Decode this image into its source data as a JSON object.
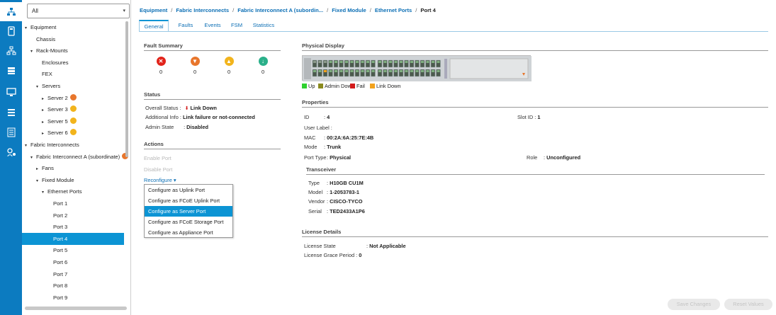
{
  "rail": {
    "icons": [
      "network-icon",
      "server-icon",
      "lan-icon",
      "storage-icon",
      "chassis-icon",
      "policy-icon",
      "list-icon",
      "admin-icon"
    ],
    "accent": "#0c7bc0"
  },
  "filter": {
    "value": "All"
  },
  "tree": [
    {
      "label": "Equipment",
      "toggle": "▾",
      "level": 0
    },
    {
      "label": "Chassis",
      "toggle": "",
      "level": 1
    },
    {
      "label": "Rack-Mounts",
      "toggle": "▾",
      "level": 1
    },
    {
      "label": "Enclosures",
      "toggle": "",
      "level": 2
    },
    {
      "label": "FEX",
      "toggle": "",
      "level": 2
    },
    {
      "label": "Servers",
      "toggle": "▾",
      "level": 2
    },
    {
      "label": "Server 2",
      "toggle": "▸",
      "level": 3,
      "badge": "#e8762c"
    },
    {
      "label": "Server 3",
      "toggle": "▸",
      "level": 3,
      "badge": "#f2b41c"
    },
    {
      "label": "Server 5",
      "toggle": "▸",
      "level": 3,
      "badge": "#f2b41c"
    },
    {
      "label": "Server 6",
      "toggle": "▸",
      "level": 3,
      "badge": "#f2b41c"
    },
    {
      "label": "Fabric Interconnects",
      "toggle": "▾",
      "level": 0
    },
    {
      "label": "Fabric Interconnect A (subordinate)",
      "toggle": "▾",
      "level": 1,
      "badge": "#e8762c"
    },
    {
      "label": "Fans",
      "toggle": "▸",
      "level": 2
    },
    {
      "label": "Fixed Module",
      "toggle": "▾",
      "level": 2
    },
    {
      "label": "Ethernet Ports",
      "toggle": "▾",
      "level": 3
    },
    {
      "label": "Port 1",
      "toggle": "",
      "level": 4
    },
    {
      "label": "Port 2",
      "toggle": "",
      "level": 4
    },
    {
      "label": "Port 3",
      "toggle": "",
      "level": 4
    },
    {
      "label": "Port 4",
      "toggle": "",
      "level": 4,
      "selected": true
    },
    {
      "label": "Port 5",
      "toggle": "",
      "level": 4
    },
    {
      "label": "Port 6",
      "toggle": "",
      "level": 4
    },
    {
      "label": "Port 7",
      "toggle": "",
      "level": 4
    },
    {
      "label": "Port 8",
      "toggle": "",
      "level": 4
    },
    {
      "label": "Port 9",
      "toggle": "",
      "level": 4
    }
  ],
  "breadcrumb": {
    "items": [
      "Equipment",
      "Fabric Interconnects",
      "Fabric Interconnect A (subordin...",
      "Fixed Module",
      "Ethernet Ports"
    ],
    "current": "Port 4"
  },
  "tabs": [
    "General",
    "Faults",
    "Events",
    "FSM",
    "Statistics"
  ],
  "fault_summary": {
    "title": "Fault Summary",
    "items": [
      {
        "name": "critical-icon",
        "glyph": "✕",
        "color": "#e2231a",
        "count": "0"
      },
      {
        "name": "major-icon",
        "glyph": "▼",
        "color": "#e8762c",
        "count": "0"
      },
      {
        "name": "minor-icon",
        "glyph": "▲",
        "color": "#f2b41c",
        "count": "0"
      },
      {
        "name": "warning-icon",
        "glyph": "↓",
        "color": "#2ab08a",
        "count": "0"
      }
    ]
  },
  "status": {
    "title": "Status",
    "overall_label": "Overall Status :",
    "overall_icon": "⬇",
    "overall_value": "Link Down",
    "info_label": "Additional Info :",
    "info_value": "Link failure or not-connected",
    "admin_label": "Admin State",
    "admin_value": "Disabled"
  },
  "actions": {
    "title": "Actions",
    "enable": "Enable Port",
    "disable": "Disable Port",
    "reconfigure": "Reconfigure ▾",
    "menu": [
      "Configure as Uplink Port",
      "Configure as FCoE Uplink Port",
      "Configure as Server Port",
      "Configure as FCoE Storage Port",
      "Configure as Appliance Port"
    ]
  },
  "physical": {
    "title": "Physical Display",
    "legend": [
      {
        "label": "Up",
        "color": "#2fd12f"
      },
      {
        "label": "Admin Down",
        "color": "#8a8a1e"
      },
      {
        "label": "Fail",
        "color": "#d21a1a"
      },
      {
        "label": "Link Down",
        "color": "#f2a21c"
      }
    ]
  },
  "properties": {
    "title": "Properties",
    "id_label": "ID",
    "id_value": "4",
    "slot_label": "Slot ID :",
    "slot_value": "1",
    "user_label": "User Label :",
    "mac_label": "MAC",
    "mac_value": "00:2A:6A:25:7E:4B",
    "mode_label": "Mode",
    "mode_value": "Trunk",
    "port_type_label": "Port Type",
    "port_type_value": "Physical",
    "role_label": "Role",
    "role_value": "Unconfigured",
    "transceiver": {
      "title": "Transceiver",
      "type_label": "Type",
      "type_value": "H10GB CU1M",
      "model_label": "Model",
      "model_value": "1-2053783-1",
      "vendor_label": "Vendor",
      "vendor_value": "CISCO-TYCO",
      "serial_label": "Serial",
      "serial_value": "TED2433A1P6"
    }
  },
  "license": {
    "title": "License Details",
    "state_label": "License State",
    "state_value": "Not Applicable",
    "grace_label": "License Grace Period :",
    "grace_value": "0"
  },
  "footer": {
    "save": "Save Changes",
    "reset": "Reset Values"
  },
  "colors": {
    "link": "#0c6fb5",
    "selection": "#0c94d4"
  }
}
